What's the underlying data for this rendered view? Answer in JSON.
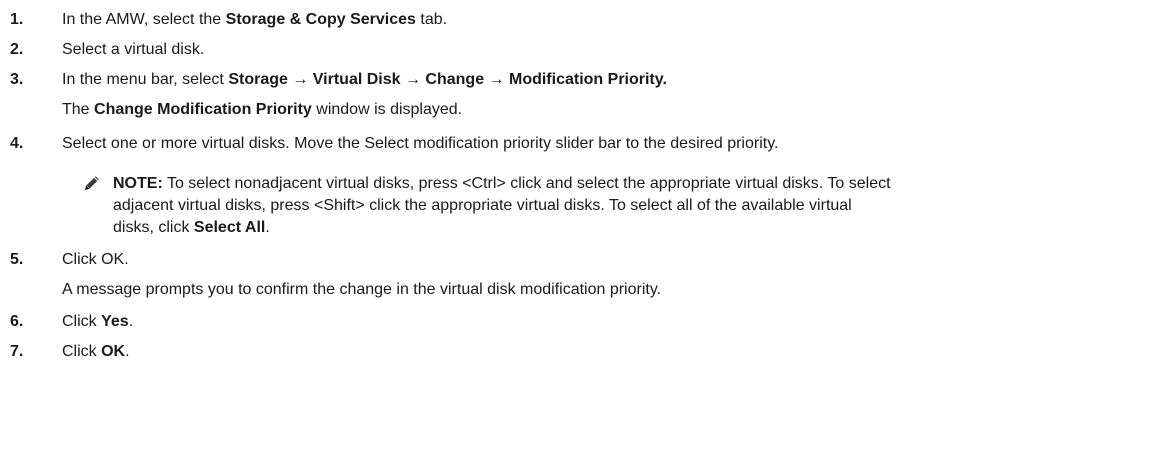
{
  "steps": [
    {
      "number": "1.",
      "parts": [
        "In the AMW, select the ",
        "Storage & Copy Services",
        " tab."
      ]
    },
    {
      "number": "2.",
      "parts": [
        "Select a virtual disk."
      ]
    },
    {
      "number": "3.",
      "parts": [
        "In the menu bar, select ",
        "Storage → Virtual Disk → Change → Modification Priority."
      ],
      "followup_parts": [
        "The ",
        "Change Modification Priority",
        " window is displayed."
      ]
    },
    {
      "number": "4.",
      "parts": [
        "Select one or more virtual disks. Move the Select modification priority slider bar to the desired priority."
      ],
      "note": {
        "icon": "pencil-note-icon",
        "label": "NOTE:",
        "line1": " To select nonadjacent virtual disks, press <Ctrl> click and select the appropriate virtual disks. To select",
        "line2": "adjacent virtual disks, press <Shift> click the appropriate virtual disks. To select all of the available virtual",
        "line3_pre": "disks, click ",
        "line3_bold": "Select All",
        "line3_post": "."
      }
    },
    {
      "number": "5.",
      "parts": [
        "Click OK."
      ],
      "followup": "A message prompts you to confirm the change in the virtual disk modification priority."
    },
    {
      "number": "6.",
      "parts": [
        "Click ",
        "Yes",
        "."
      ]
    },
    {
      "number": "7.",
      "parts": [
        "Click ",
        "OK",
        "."
      ]
    }
  ]
}
